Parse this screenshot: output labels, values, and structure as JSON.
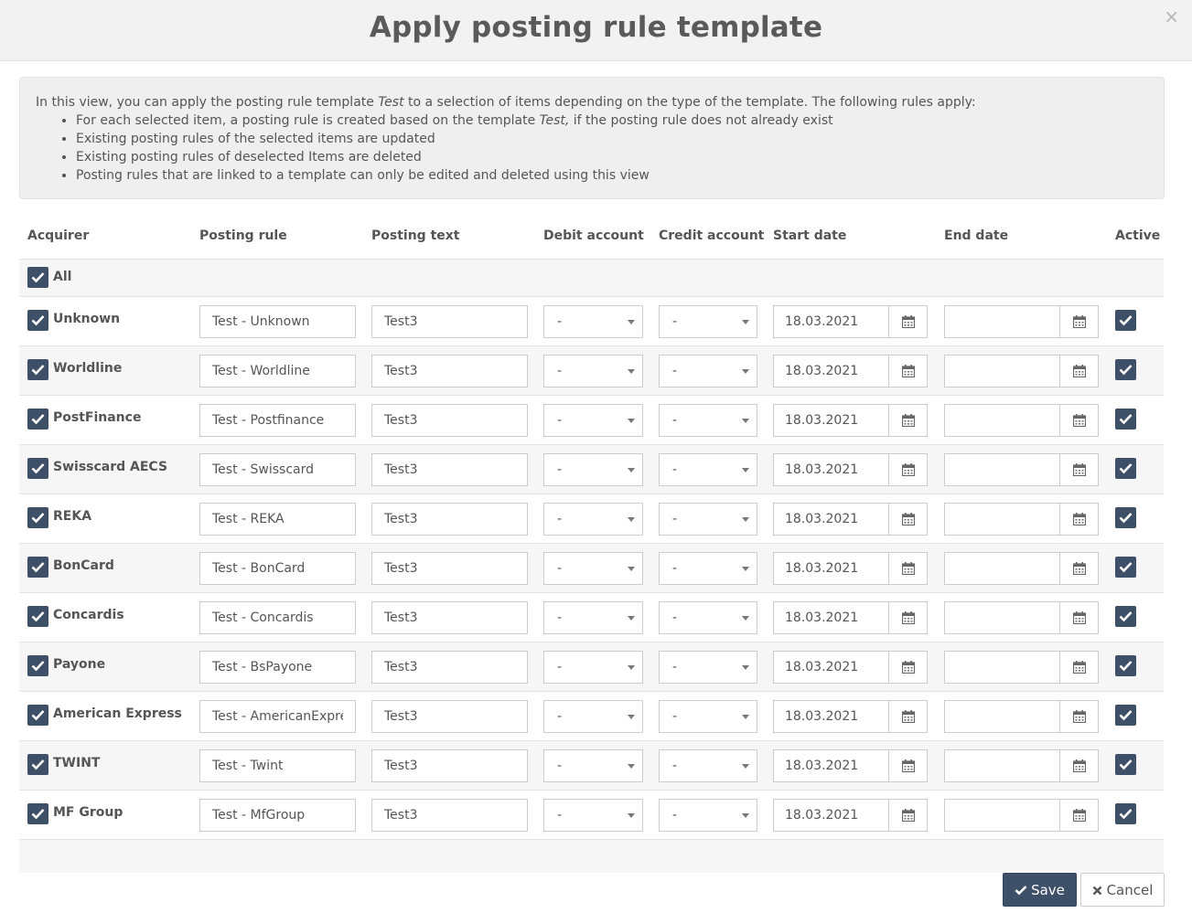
{
  "dialog": {
    "title": "Apply posting rule template",
    "close_icon": "×"
  },
  "info": {
    "intro_prefix": "In this view, you can apply the posting rule template ",
    "template_name": "Test",
    "intro_suffix": " to a selection of items depending on the type of the template. The following rules apply:",
    "bullet1_prefix": "For each selected item, a posting rule is created based on the template ",
    "bullet1_template": "Test,",
    "bullet1_suffix": " if the posting rule does not already exist",
    "bullet2": "Existing posting rules of the selected items are updated",
    "bullet3": "Existing posting rules of deselected Items are deleted",
    "bullet4": "Posting rules that are linked to a template can only be edited and deleted using this view"
  },
  "table": {
    "headers": {
      "acquirer": "Acquirer",
      "posting_rule": "Posting rule",
      "posting_text": "Posting text",
      "debit_account": "Debit account",
      "credit_account": "Credit account",
      "start_date": "Start date",
      "end_date": "End date",
      "active": "Active"
    },
    "all_label": "All",
    "all_checked": true,
    "rows": [
      {
        "acquirer": "Unknown",
        "posting_rule": "Test - Unknown",
        "posting_text": "Test3",
        "debit": "-",
        "credit": "-",
        "start_date": "18.03.2021",
        "end_date": "",
        "selected": true,
        "active": true
      },
      {
        "acquirer": "Worldline",
        "posting_rule": "Test - Worldline",
        "posting_text": "Test3",
        "debit": "-",
        "credit": "-",
        "start_date": "18.03.2021",
        "end_date": "",
        "selected": true,
        "active": true
      },
      {
        "acquirer": "PostFinance",
        "posting_rule": "Test - Postfinance",
        "posting_text": "Test3",
        "debit": "-",
        "credit": "-",
        "start_date": "18.03.2021",
        "end_date": "",
        "selected": true,
        "active": true
      },
      {
        "acquirer": "Swisscard AECS",
        "posting_rule": "Test - Swisscard",
        "posting_text": "Test3",
        "debit": "-",
        "credit": "-",
        "start_date": "18.03.2021",
        "end_date": "",
        "selected": true,
        "active": true
      },
      {
        "acquirer": "REKA",
        "posting_rule": "Test - REKA",
        "posting_text": "Test3",
        "debit": "-",
        "credit": "-",
        "start_date": "18.03.2021",
        "end_date": "",
        "selected": true,
        "active": true
      },
      {
        "acquirer": "BonCard",
        "posting_rule": "Test - BonCard",
        "posting_text": "Test3",
        "debit": "-",
        "credit": "-",
        "start_date": "18.03.2021",
        "end_date": "",
        "selected": true,
        "active": true
      },
      {
        "acquirer": "Concardis",
        "posting_rule": "Test - Concardis",
        "posting_text": "Test3",
        "debit": "-",
        "credit": "-",
        "start_date": "18.03.2021",
        "end_date": "",
        "selected": true,
        "active": true
      },
      {
        "acquirer": "Payone",
        "posting_rule": "Test - BsPayone",
        "posting_text": "Test3",
        "debit": "-",
        "credit": "-",
        "start_date": "18.03.2021",
        "end_date": "",
        "selected": true,
        "active": true
      },
      {
        "acquirer": "American Express",
        "posting_rule": "Test - AmericanExpre",
        "posting_text": "Test3",
        "debit": "-",
        "credit": "-",
        "start_date": "18.03.2021",
        "end_date": "",
        "selected": true,
        "active": true
      },
      {
        "acquirer": "TWINT",
        "posting_rule": "Test - Twint",
        "posting_text": "Test3",
        "debit": "-",
        "credit": "-",
        "start_date": "18.03.2021",
        "end_date": "",
        "selected": true,
        "active": true
      },
      {
        "acquirer": "MF Group",
        "posting_rule": "Test - MfGroup",
        "posting_text": "Test3",
        "debit": "-",
        "credit": "-",
        "start_date": "18.03.2021",
        "end_date": "",
        "selected": true,
        "active": true
      }
    ]
  },
  "buttons": {
    "save": "Save",
    "cancel": "Cancel"
  },
  "colors": {
    "primary": "#3e5068",
    "header_bg": "#f2f2f2",
    "info_bg": "#efefef"
  }
}
